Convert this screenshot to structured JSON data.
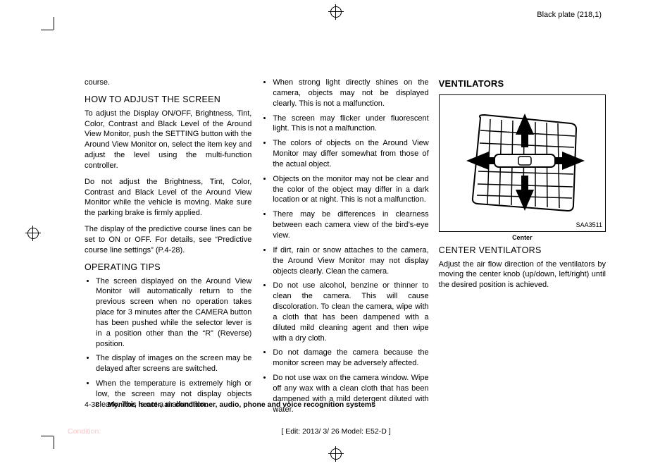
{
  "header": {
    "plate": "Black plate (218,1)"
  },
  "col1": {
    "lead": "course.",
    "h1": "HOW TO ADJUST THE SCREEN",
    "p1": "To adjust the Display ON/OFF, Brightness, Tint, Color, Contrast and Black Level of the Around View Monitor, push the SETTING button with the Around View Monitor on, select the item key and adjust the level using the multi-function controller.",
    "p2": "Do not adjust the Brightness, Tint, Color, Contrast and Black Level of the Around View Monitor while the vehicle is moving. Make sure the parking brake is firmly applied.",
    "p3": "The display of the predictive course lines can be set to ON or OFF. For details, see “Predictive course line settings” (P.4-28).",
    "h2": "OPERATING TIPS",
    "b1": "The screen displayed on the Around View Monitor will automatically return to the previous screen when no operation takes place for 3 minutes after the CAMERA button has been pushed while the selector lever is in a position other than the “R” (Reverse) position.",
    "b2": "The display of images on the screen may be delayed after screens are switched.",
    "b3": "When the temperature is extremely high or low, the screen may not display objects clearly. This is not a malfunction."
  },
  "col2": {
    "b1": "When strong light directly shines on the camera, objects may not be displayed clearly. This is not a malfunction.",
    "b2": "The screen may flicker under fluorescent light. This is not a malfunction.",
    "b3": "The colors of objects on the Around View Monitor may differ somewhat from those of the actual object.",
    "b4": "Objects on the monitor may not be clear and the color of the object may differ in a dark location or at night. This is not a malfunction.",
    "b5": "There may be differences in clearness between each camera view of the bird’s-eye view.",
    "b6": "If dirt, rain or snow attaches to the camera, the Around View Monitor may not display objects clearly. Clean the camera.",
    "b7": "Do not use alcohol, benzine or thinner to clean the camera. This will cause discoloration. To clean the camera, wipe with a cloth that has been dampened with a diluted mild cleaning agent and then wipe with a dry cloth.",
    "b8": "Do not damage the camera because the monitor screen may be adversely affected.",
    "b9": "Do not use wax on the camera window. Wipe off any wax with a clean cloth that has been dampened with a mild detergent diluted with water."
  },
  "col3": {
    "section": "VENTILATORS",
    "fig_code": "SAA3511",
    "fig_caption": "Center",
    "h1": "CENTER VENTILATORS",
    "p1": "Adjust the air flow direction of the ventilators by moving the center knob (up/down, left/right) until the desired position is achieved."
  },
  "footer": {
    "page": "4-38",
    "title": "Monitor, heater, air conditioner, audio, phone and voice recognition systems",
    "edit": "[ Edit: 2013/ 3/ 26   Model: E52-D ]",
    "condition": "Condition:"
  }
}
